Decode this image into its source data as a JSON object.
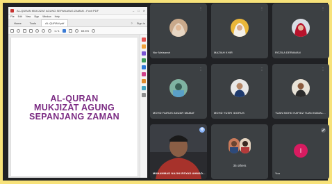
{
  "pdf_viewer": {
    "window_title": "AL-QURAN MUKJIZAT AGUNG SEPANJANG ZAMAN - Foxit PDF",
    "menu": [
      "File",
      "Edit",
      "View",
      "Sign",
      "Window",
      "Help"
    ],
    "tabs": [
      {
        "label": "Home"
      },
      {
        "label": "Tools"
      },
      {
        "label": "AL-QURAN.pdf"
      }
    ],
    "tab_right": [
      "Sign in"
    ],
    "page_indicator": "1 / 1",
    "zoom": "69.5%",
    "doc_title": [
      "AL-QURAN",
      "MUKJIZAT AGUNG",
      "SEPANJANG ZAMAN"
    ]
  },
  "meeting": {
    "participants": [
      {
        "name": "Nur Maisarah"
      },
      {
        "name": "MAZIAH KHIR"
      },
      {
        "name": "ROZILA DERAMAN"
      },
      {
        "name": "MOHD FAIRUS ANUAR MAMAT"
      },
      {
        "name": "MOHD YUSRI IDORUS"
      },
      {
        "name": "TUAN MOHD HAFIDZ TUAN KAMAL..."
      },
      {
        "name": "MUHAMMAD NAJIH IRSYAD AHMAD..."
      }
    ],
    "others": {
      "label": "35 others"
    },
    "self": {
      "name": "You",
      "initial": "I"
    }
  },
  "colors": {
    "background": "#f7e27a",
    "doc_title": "#7b2b83",
    "tile": "#3c4043",
    "self_avatar": "#d81b60"
  }
}
